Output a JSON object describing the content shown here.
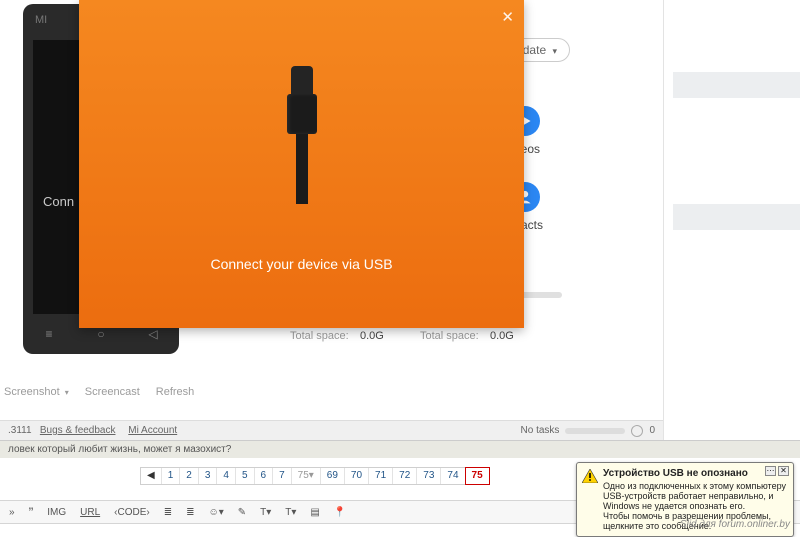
{
  "phone": {
    "brand": "MI",
    "label": "Conn",
    "nav": {
      "menu": "≡",
      "home": "○",
      "back": "◁"
    }
  },
  "update": {
    "label": "Update",
    "caret": "▾"
  },
  "features": {
    "videos_label": "deos",
    "contacts_label": "ntacts"
  },
  "storage": {
    "a_label": "Total space:",
    "a_value": "0.0G",
    "b_label": "Total space:",
    "b_value": "0.0G"
  },
  "tools": {
    "screenshot": "Screenshot",
    "screencast": "Screencast",
    "refresh": "Refresh",
    "caret": "▾"
  },
  "modal": {
    "text": "Connect your device via USB"
  },
  "footer": {
    "version": ".3111",
    "bugs": "Bugs & feedback",
    "account": "Mi Account",
    "notasks": "No tasks",
    "zero": "0"
  },
  "forum_q": "ловек который любит жизнь, может я мазохист?",
  "pager": {
    "prev": "◀",
    "pages_a": [
      "1",
      "2",
      "3",
      "4",
      "5",
      "6",
      "7"
    ],
    "sep": "75▾",
    "pages_b": [
      "69",
      "70",
      "71",
      "72",
      "73",
      "74"
    ],
    "current": "75"
  },
  "toolbar": {
    "items_left": "»",
    "img": "IMG",
    "url": "URL",
    "code": "‹CODE›",
    "list1": "≣",
    "list2": "≣",
    "smile": "☺▾",
    "draw": "✎",
    "tcolor": "T▾",
    "tsize": "T▾",
    "block": "▤",
    "pin": "📍"
  },
  "balloon": {
    "title": "Устройство USB не опознано",
    "body1": "Одно из подключенных к этому компьютеру USB-устройств работает неправильно, и Windows не удается опознать его.",
    "body2": "Чтобы помочь в разрешении проблемы, щелкните это сообщение."
  },
  "watermark": "Slid для forum.onliner.by"
}
